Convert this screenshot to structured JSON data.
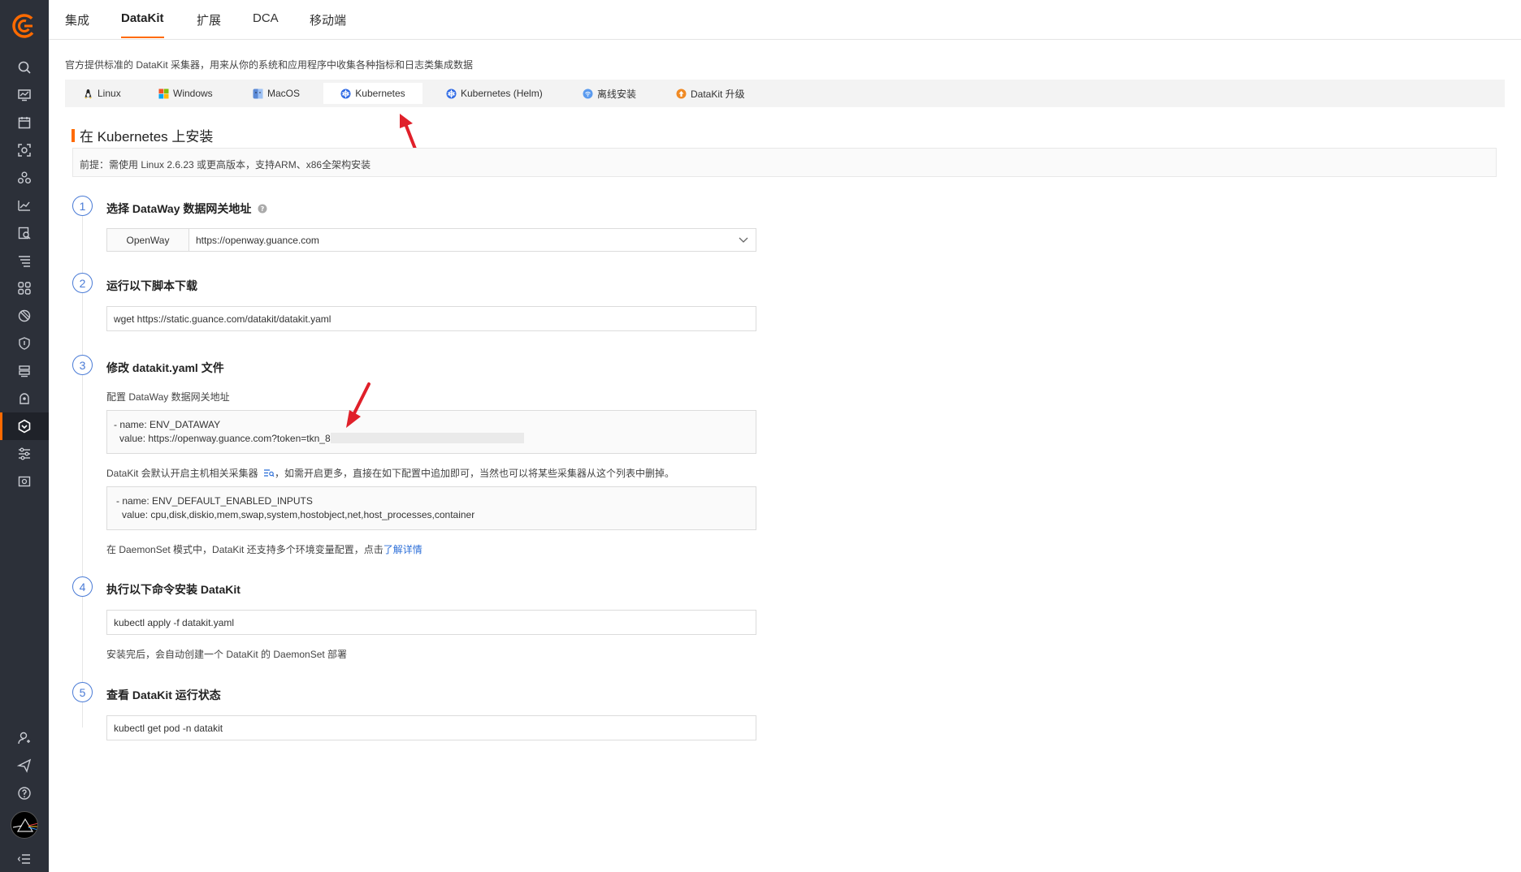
{
  "top_tabs": [
    "集成",
    "DataKit",
    "扩展",
    "DCA",
    "移动端"
  ],
  "description": "官方提供标准的 DataKit 采集器，用来从你的系统和应用程序中收集各种指标和日志类集成数据",
  "os_tabs": [
    "Linux",
    "Windows",
    "MacOS",
    "Kubernetes",
    "Kubernetes (Helm)",
    "离线安装",
    "DataKit 升级"
  ],
  "section_title": "在 Kubernetes 上安装",
  "notice": "前提：需使用 Linux 2.6.23 或更高版本，支持ARM、x86全架构安装",
  "steps": [
    {
      "num": "1",
      "title": "选择 DataWay 数据网关地址"
    },
    {
      "num": "2",
      "title": "运行以下脚本下载"
    },
    {
      "num": "3",
      "title": "修改 datakit.yaml 文件"
    },
    {
      "num": "4",
      "title": "执行以下命令安装 DataKit"
    },
    {
      "num": "5",
      "title": "查看 DataKit 运行状态"
    }
  ],
  "dataway": {
    "label": "OpenWay",
    "value": "https://openway.guance.com"
  },
  "download_cmd": "wget https://static.guance.com/datakit/datakit.yaml",
  "config_dataway_label": "配置 DataWay 数据网关地址",
  "env_dataway": {
    "line1": "- name: ENV_DATAWAY",
    "line2": "value: https://openway.guance.com?token=tkn_8"
  },
  "default_inputs_note_pre": "DataKit 会默认开启主机相关采集器",
  "default_inputs_note_post": "，如需开启更多，直接在如下配置中追加即可，当然也可以将某些采集器从这个列表中删掉。",
  "env_inputs": {
    "line1": "- name: ENV_DEFAULT_ENABLED_INPUTS",
    "line2": "value: cpu,disk,diskio,mem,swap,system,hostobject,net,host_processes,container"
  },
  "daemonset_note": "在 DaemonSet 模式中，DataKit 还支持多个环境变量配置，点击",
  "daemonset_link": "了解详情",
  "install_cmd": "kubectl apply -f datakit.yaml",
  "install_note": "安装完后，会自动创建一个 DataKit 的 DaemonSet 部署",
  "status_cmd": "kubectl get pod -n datakit",
  "colors": {
    "accent": "#ff6a00",
    "sidebar": "#2c3039",
    "link": "#2d6fd8",
    "arrow": "#e0202a"
  }
}
